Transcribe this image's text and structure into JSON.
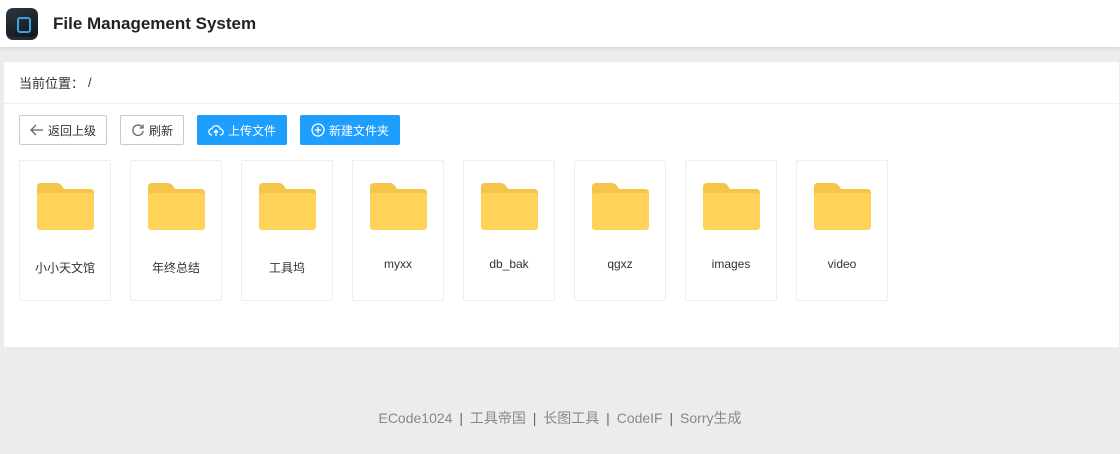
{
  "header": {
    "title": "File Management System"
  },
  "breadcrumb": {
    "label": "当前位置：",
    "path": "/"
  },
  "toolbar": {
    "back_label": "返回上级",
    "refresh_label": "刷新",
    "upload_label": "上传文件",
    "new_folder_label": "新建文件夹"
  },
  "colors": {
    "accent": "#1e9fff",
    "folder": "#ffd25a",
    "folder_tab": "#f4c548",
    "page_bg": "#ececec"
  },
  "folders": [
    {
      "name": "小小天文馆"
    },
    {
      "name": "年终总结"
    },
    {
      "name": "工具坞"
    },
    {
      "name": "myxx"
    },
    {
      "name": "db_bak"
    },
    {
      "name": "qgxz"
    },
    {
      "name": "images"
    },
    {
      "name": "video"
    }
  ],
  "footer": {
    "links": [
      "ECode1024",
      "工具帝国",
      "长图工具",
      "CodeIF",
      "Sorry生成"
    ],
    "separator": "|"
  }
}
